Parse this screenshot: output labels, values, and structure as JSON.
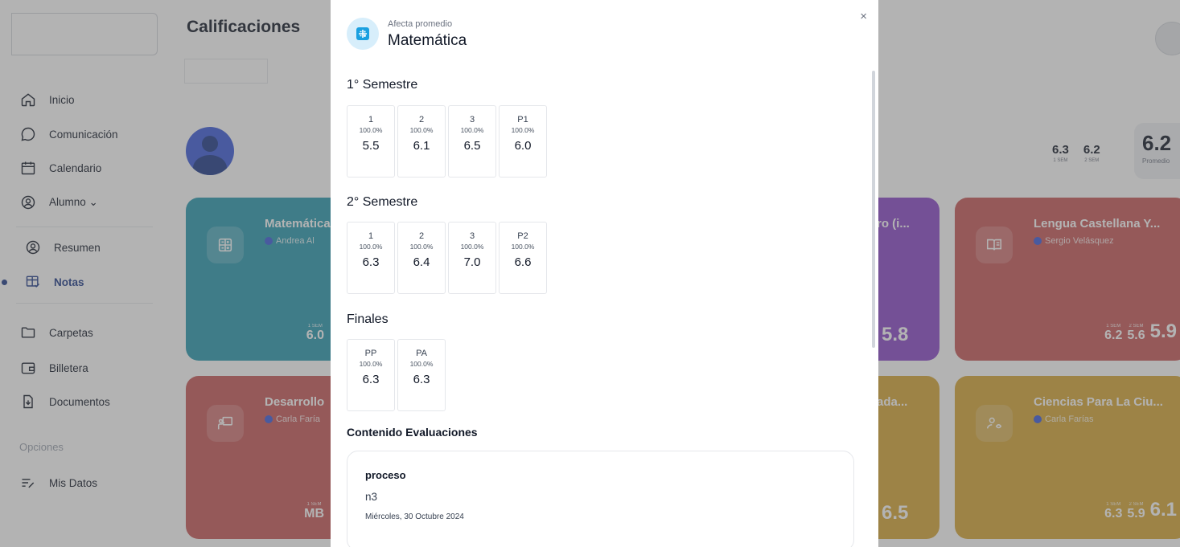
{
  "sidebar": {
    "items": [
      {
        "label": "Inicio",
        "icon": "home-icon"
      },
      {
        "label": "Comunicación",
        "icon": "chat-icon"
      },
      {
        "label": "Calendario",
        "icon": "calendar-icon"
      },
      {
        "label": "Alumno ⌄",
        "icon": "user-circle-icon"
      },
      {
        "label": "Resumen",
        "icon": "user-circle-icon"
      },
      {
        "label": "Notas",
        "icon": "grades-icon"
      },
      {
        "label": "Carpetas",
        "icon": "folder-icon"
      },
      {
        "label": "Billetera",
        "icon": "wallet-icon"
      },
      {
        "label": "Documentos",
        "icon": "document-icon"
      },
      {
        "label": "Mis Datos",
        "icon": "list-edit-icon"
      }
    ],
    "section_options": "Opciones"
  },
  "page": {
    "title": "Calificaciones",
    "averages": {
      "sem1_value": "6.3",
      "sem1_label": "1 SEM",
      "sem2_value": "6.2",
      "sem2_label": "2 SEM",
      "overall_value": "6.2",
      "overall_label": "Promedio"
    }
  },
  "cards": [
    {
      "title": "Matemática",
      "teacher": "Andrea Al",
      "sem1_label": "1 SEM",
      "sem1_value": "6.0",
      "color": "#2a9ab0"
    },
    {
      "title": "ro (i...",
      "final": "5.8",
      "color": "#8b49c9"
    },
    {
      "title": "Lengua Castellana Y...",
      "teacher": "Sergio Velásquez",
      "sem1_label": "1 SEM",
      "sem1_value": "6.2",
      "sem2_label": "2 SEM",
      "sem2_value": "5.6",
      "final": "5.9",
      "color": "#c85a5a"
    },
    {
      "title": "Desarrollo",
      "teacher": "Carla Faría",
      "sem1_label": "1 SEM",
      "sem1_value": "MB",
      "color": "#c85a5a"
    },
    {
      "title": "ada...",
      "final": "6.5",
      "color": "#d6a637"
    },
    {
      "title": "Ciencias Para La Ciu...",
      "teacher": "Carla Farías",
      "sem1_label": "1 SEM",
      "sem1_value": "6.3",
      "sem2_label": "2 SEM",
      "sem2_value": "5.9",
      "final": "6.1",
      "color": "#d6a637"
    }
  ],
  "modal": {
    "affects": "Afecta promedio",
    "title": "Matemática",
    "close": "×",
    "sections": [
      {
        "title": "1° Semestre",
        "grades": [
          {
            "n": "1",
            "pct": "100.0%",
            "val": "5.5"
          },
          {
            "n": "2",
            "pct": "100.0%",
            "val": "6.1"
          },
          {
            "n": "3",
            "pct": "100.0%",
            "val": "6.5"
          },
          {
            "n": "P1",
            "pct": "100.0%",
            "val": "6.0"
          }
        ]
      },
      {
        "title": "2° Semestre",
        "grades": [
          {
            "n": "1",
            "pct": "100.0%",
            "val": "6.3"
          },
          {
            "n": "2",
            "pct": "100.0%",
            "val": "6.4"
          },
          {
            "n": "3",
            "pct": "100.0%",
            "val": "7.0"
          },
          {
            "n": "P2",
            "pct": "100.0%",
            "val": "6.6"
          }
        ]
      },
      {
        "title": "Finales",
        "grades": [
          {
            "n": "PP",
            "pct": "100.0%",
            "val": "6.3"
          },
          {
            "n": "PA",
            "pct": "100.0%",
            "val": "6.3"
          }
        ]
      }
    ],
    "content_title": "Contenido Evaluaciones",
    "evaluation": {
      "title": "proceso",
      "description": "n3",
      "date": "Miércoles, 30 Octubre 2024"
    }
  }
}
